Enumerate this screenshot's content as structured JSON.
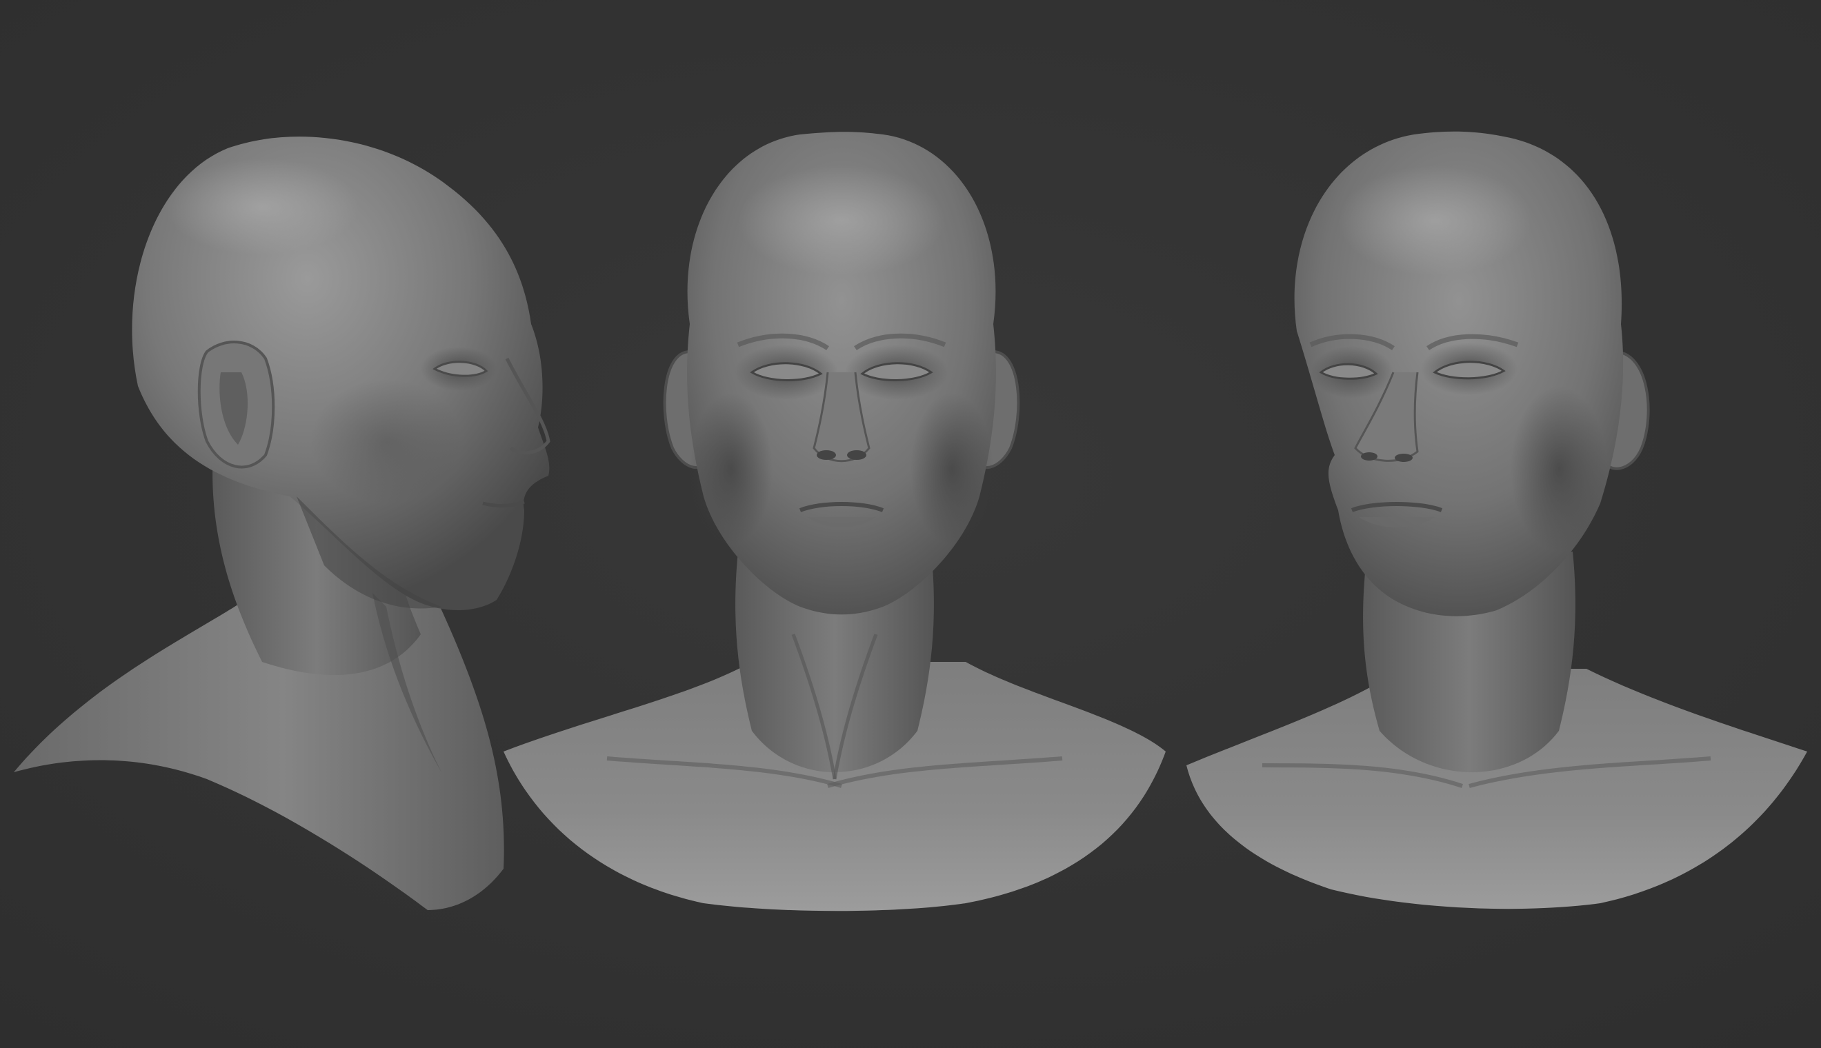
{
  "scene": {
    "subject": "3d-sculpt-male-head-turnaround",
    "views": [
      {
        "id": "profile-right",
        "facing": "right"
      },
      {
        "id": "front",
        "facing": "front"
      },
      {
        "id": "three-quarter-left",
        "facing": "left"
      }
    ],
    "colors": {
      "background": "#333333",
      "clay_light": "#8e8e8e",
      "clay_mid": "#6e6e6e",
      "clay_dark": "#3c3c3c"
    }
  }
}
